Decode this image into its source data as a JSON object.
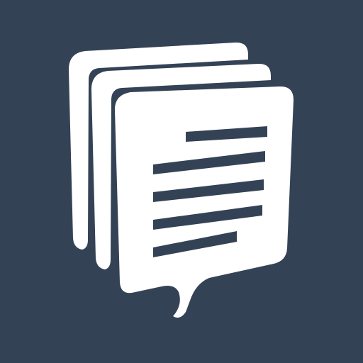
{
  "app_icon": {
    "name": "stacked-speech-bubble-documents-icon",
    "colors": {
      "background": "#344256",
      "foreground": "#FFFFFF"
    }
  }
}
